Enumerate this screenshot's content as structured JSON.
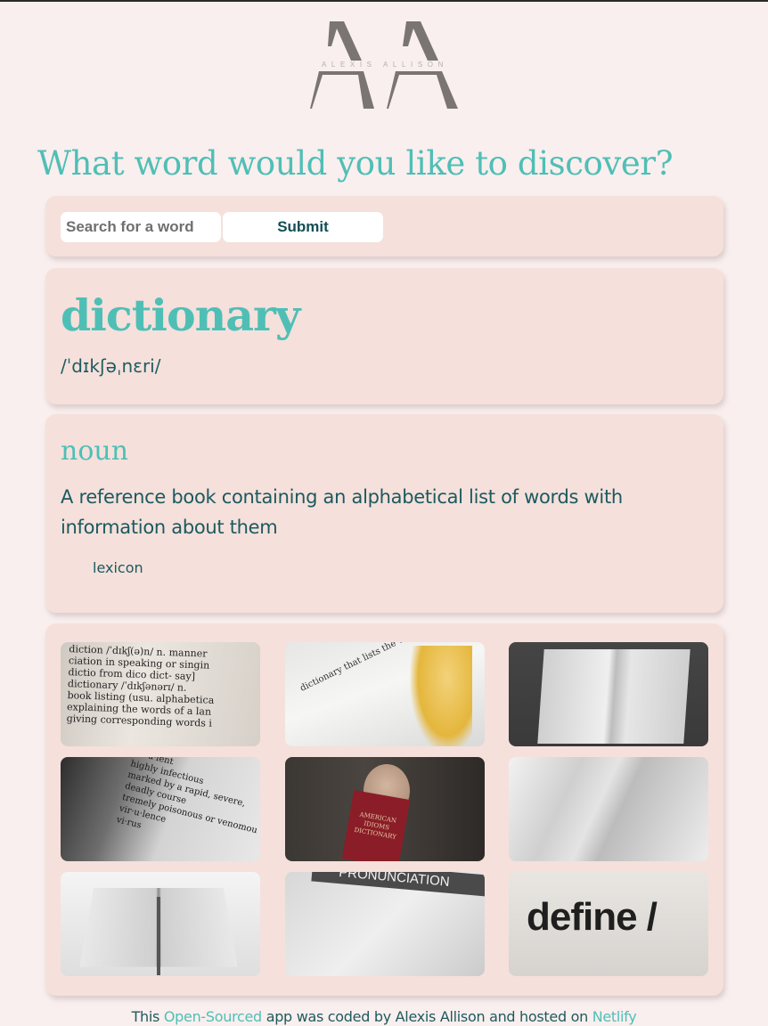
{
  "logo": {
    "monogram": "AA",
    "name": "ALEXIS ALLISON"
  },
  "heading": "What word would you like to discover?",
  "search": {
    "placeholder": "Search for a word",
    "value": "",
    "submit_label": "Submit"
  },
  "result": {
    "word": "dictionary",
    "phonetic": "/ˈdɪkʃəˌnɛri/",
    "meanings": [
      {
        "part_of_speech": "noun",
        "definition": "A reference book containing an alphabetical list of words with information about them",
        "synonyms": [
          "lexicon"
        ]
      }
    ]
  },
  "gallery": {
    "photos": [
      {
        "alt": "dictionary page close-up with diction and dictionary entries",
        "text": "diction /ˈdɪkʃ(ə)n/ n. manner\nciation in speaking or singin\ndictio from dico dict- say]\ndictionary /ˈdɪkʃənərɪ/ n.\nbook listing (usu. alphabetica\nexplaining the words of a lan\ngiving corresponding words i"
      },
      {
        "alt": "dictionary page with golden tassel bookmark",
        "text": "dictionary that lists the words"
      },
      {
        "alt": "hand flipping pages of an open dictionary",
        "text": ""
      },
      {
        "alt": "dictionary page with virulent and virus entries",
        "text": "vir·u·lent\nhighly infectious\nmarked by a rapid, severe,\ndeadly course\ntremely poisonous or venomou\nvir·u·lence\nvi·rus"
      },
      {
        "alt": "man holding American Idioms Dictionary",
        "text": "AMERICAN IDIOMS DICTIONARY"
      },
      {
        "alt": "open dictionary pages close-up",
        "text": ""
      },
      {
        "alt": "open dictionary with a pen in the middle",
        "text": ""
      },
      {
        "alt": "pronunciation key page",
        "text": "PRONUNCIATION"
      },
      {
        "alt": "close-up of the word define",
        "text": "define /"
      }
    ]
  },
  "footer": {
    "prefix": "This ",
    "link1": "Open-Sourced",
    "middle": " app was coded by Alexis Allison and hosted on ",
    "link2": "Netlify"
  },
  "colors": {
    "accent": "#4fbfb6",
    "text": "#1b5a5f",
    "background": "#f9efee",
    "card": "#f5e0db"
  }
}
